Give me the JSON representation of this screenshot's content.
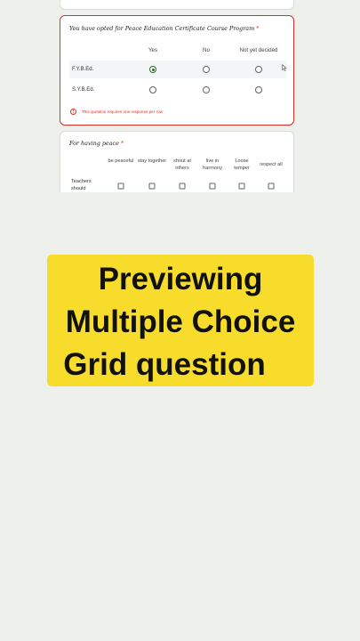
{
  "q1": {
    "title": "You have opted for Peace Education Certificate Course Program",
    "required_mark": "*",
    "columns": [
      "Yes",
      "No",
      "Not yet decided"
    ],
    "rows": [
      "F.Y.B.Ed.",
      "S.Y.B.Ed."
    ],
    "selected": {
      "row": 0,
      "column": 0
    },
    "error": "This question requires one response per row",
    "error_icon": "!"
  },
  "q2": {
    "title": "For having peace",
    "required_mark": "*",
    "columns": [
      "be peaceful",
      "stay together",
      "shout at others",
      "live in harmony",
      "Loose temper",
      "respect all"
    ],
    "rows": [
      "Teachers should"
    ]
  },
  "caption": {
    "lines": [
      "Previewing",
      "Multiple Choice",
      "Grid question"
    ]
  },
  "colors": {
    "background": "#eef0ec",
    "error": "#d93025",
    "caption_bg": "#f8dc2b",
    "selected_radio": "#1e6f1e"
  }
}
